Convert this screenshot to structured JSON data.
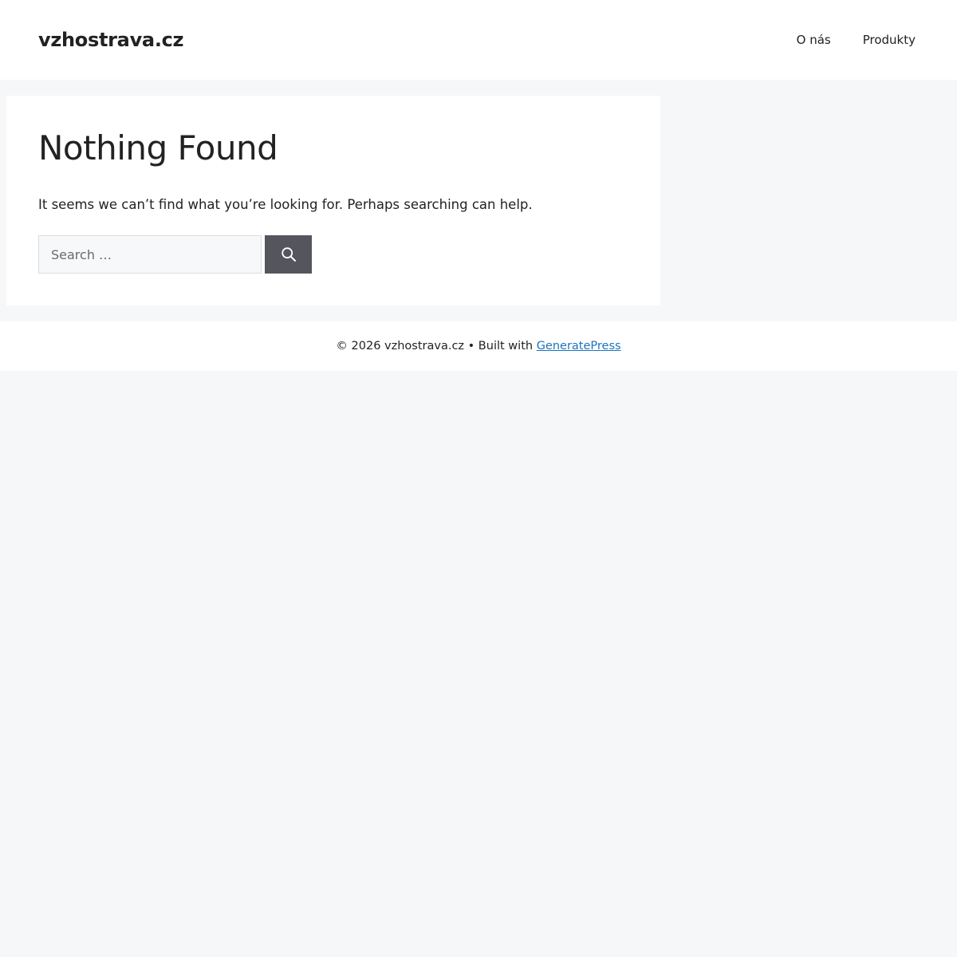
{
  "header": {
    "site_title": "vzhostrava.cz",
    "nav": [
      {
        "label": "O nás"
      },
      {
        "label": "Produkty"
      }
    ]
  },
  "main": {
    "title": "Nothing Found",
    "message": "It seems we can’t find what you’re looking for. Perhaps searching can help.",
    "search": {
      "placeholder": "Search …",
      "value": "",
      "button_icon": "search-icon"
    }
  },
  "footer": {
    "copyright": "© 2026 vzhostrava.cz • Built with",
    "link_text": "GeneratePress"
  },
  "colors": {
    "page_background": "#f6f7f9",
    "surface": "#ffffff",
    "text": "#222222",
    "search_button": "#55555e",
    "link": "#1e73be"
  }
}
